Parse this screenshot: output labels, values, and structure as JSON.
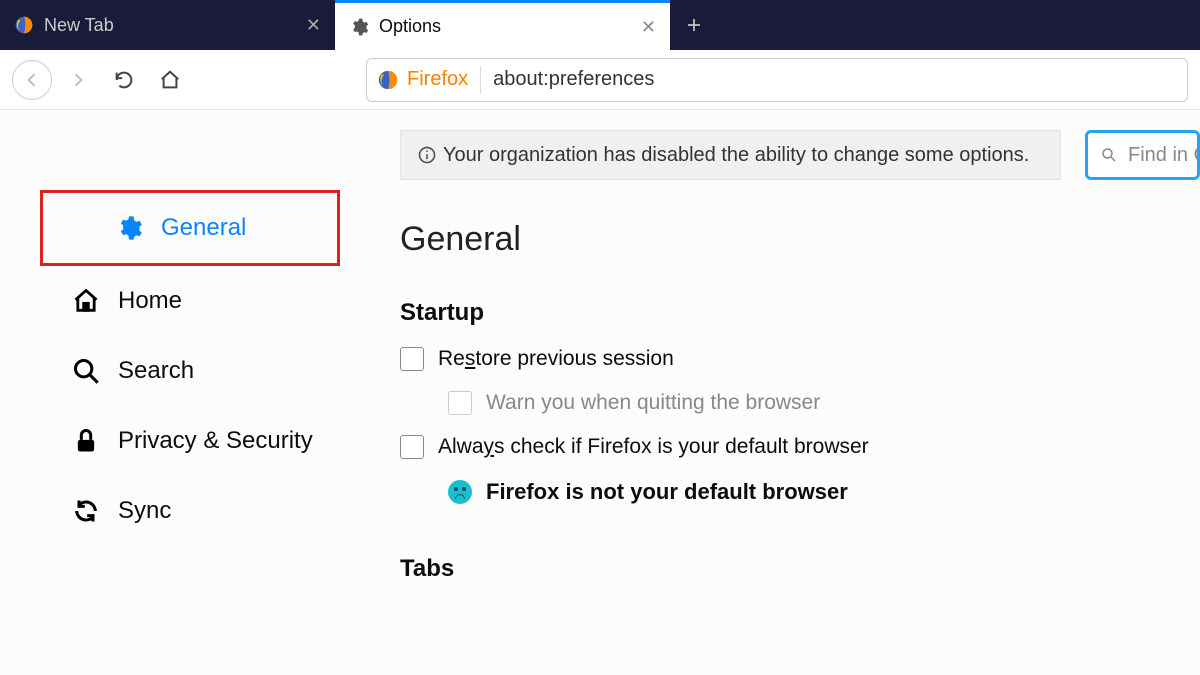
{
  "tabs": {
    "items": [
      {
        "label": "New Tab",
        "active": false
      },
      {
        "label": "Options",
        "active": true
      }
    ]
  },
  "urlbar": {
    "identity": "Firefox",
    "url": "about:preferences"
  },
  "sidebar": {
    "items": [
      {
        "label": "General"
      },
      {
        "label": "Home"
      },
      {
        "label": "Search"
      },
      {
        "label": "Privacy & Security"
      },
      {
        "label": "Sync"
      }
    ]
  },
  "notice": "Your organization has disabled the ability to change some options.",
  "search": {
    "placeholder": "Find in Options"
  },
  "page": {
    "title": "General",
    "sections": {
      "startup": {
        "heading": "Startup",
        "restore_pre": "Re",
        "restore_u": "s",
        "restore_post": "tore previous session",
        "warn": "Warn you when quitting the browser",
        "always_pre": "Alwa",
        "always_u": "y",
        "always_post": "s check if Firefox is your default browser",
        "status": "Firefox is not your default browser"
      },
      "tabs": {
        "heading": "Tabs"
      }
    }
  }
}
